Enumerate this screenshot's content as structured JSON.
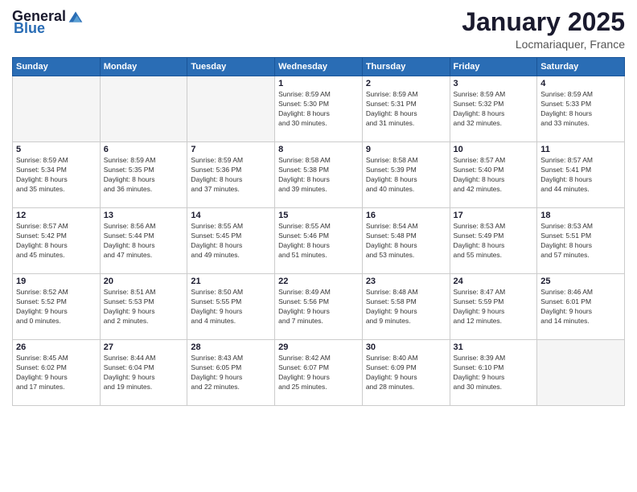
{
  "header": {
    "logo_general": "General",
    "logo_blue": "Blue",
    "month_title": "January 2025",
    "location": "Locmariaquer, France"
  },
  "weekdays": [
    "Sunday",
    "Monday",
    "Tuesday",
    "Wednesday",
    "Thursday",
    "Friday",
    "Saturday"
  ],
  "weeks": [
    [
      {
        "day": "",
        "info": ""
      },
      {
        "day": "",
        "info": ""
      },
      {
        "day": "",
        "info": ""
      },
      {
        "day": "1",
        "info": "Sunrise: 8:59 AM\nSunset: 5:30 PM\nDaylight: 8 hours\nand 30 minutes."
      },
      {
        "day": "2",
        "info": "Sunrise: 8:59 AM\nSunset: 5:31 PM\nDaylight: 8 hours\nand 31 minutes."
      },
      {
        "day": "3",
        "info": "Sunrise: 8:59 AM\nSunset: 5:32 PM\nDaylight: 8 hours\nand 32 minutes."
      },
      {
        "day": "4",
        "info": "Sunrise: 8:59 AM\nSunset: 5:33 PM\nDaylight: 8 hours\nand 33 minutes."
      }
    ],
    [
      {
        "day": "5",
        "info": "Sunrise: 8:59 AM\nSunset: 5:34 PM\nDaylight: 8 hours\nand 35 minutes."
      },
      {
        "day": "6",
        "info": "Sunrise: 8:59 AM\nSunset: 5:35 PM\nDaylight: 8 hours\nand 36 minutes."
      },
      {
        "day": "7",
        "info": "Sunrise: 8:59 AM\nSunset: 5:36 PM\nDaylight: 8 hours\nand 37 minutes."
      },
      {
        "day": "8",
        "info": "Sunrise: 8:58 AM\nSunset: 5:38 PM\nDaylight: 8 hours\nand 39 minutes."
      },
      {
        "day": "9",
        "info": "Sunrise: 8:58 AM\nSunset: 5:39 PM\nDaylight: 8 hours\nand 40 minutes."
      },
      {
        "day": "10",
        "info": "Sunrise: 8:57 AM\nSunset: 5:40 PM\nDaylight: 8 hours\nand 42 minutes."
      },
      {
        "day": "11",
        "info": "Sunrise: 8:57 AM\nSunset: 5:41 PM\nDaylight: 8 hours\nand 44 minutes."
      }
    ],
    [
      {
        "day": "12",
        "info": "Sunrise: 8:57 AM\nSunset: 5:42 PM\nDaylight: 8 hours\nand 45 minutes."
      },
      {
        "day": "13",
        "info": "Sunrise: 8:56 AM\nSunset: 5:44 PM\nDaylight: 8 hours\nand 47 minutes."
      },
      {
        "day": "14",
        "info": "Sunrise: 8:55 AM\nSunset: 5:45 PM\nDaylight: 8 hours\nand 49 minutes."
      },
      {
        "day": "15",
        "info": "Sunrise: 8:55 AM\nSunset: 5:46 PM\nDaylight: 8 hours\nand 51 minutes."
      },
      {
        "day": "16",
        "info": "Sunrise: 8:54 AM\nSunset: 5:48 PM\nDaylight: 8 hours\nand 53 minutes."
      },
      {
        "day": "17",
        "info": "Sunrise: 8:53 AM\nSunset: 5:49 PM\nDaylight: 8 hours\nand 55 minutes."
      },
      {
        "day": "18",
        "info": "Sunrise: 8:53 AM\nSunset: 5:51 PM\nDaylight: 8 hours\nand 57 minutes."
      }
    ],
    [
      {
        "day": "19",
        "info": "Sunrise: 8:52 AM\nSunset: 5:52 PM\nDaylight: 9 hours\nand 0 minutes."
      },
      {
        "day": "20",
        "info": "Sunrise: 8:51 AM\nSunset: 5:53 PM\nDaylight: 9 hours\nand 2 minutes."
      },
      {
        "day": "21",
        "info": "Sunrise: 8:50 AM\nSunset: 5:55 PM\nDaylight: 9 hours\nand 4 minutes."
      },
      {
        "day": "22",
        "info": "Sunrise: 8:49 AM\nSunset: 5:56 PM\nDaylight: 9 hours\nand 7 minutes."
      },
      {
        "day": "23",
        "info": "Sunrise: 8:48 AM\nSunset: 5:58 PM\nDaylight: 9 hours\nand 9 minutes."
      },
      {
        "day": "24",
        "info": "Sunrise: 8:47 AM\nSunset: 5:59 PM\nDaylight: 9 hours\nand 12 minutes."
      },
      {
        "day": "25",
        "info": "Sunrise: 8:46 AM\nSunset: 6:01 PM\nDaylight: 9 hours\nand 14 minutes."
      }
    ],
    [
      {
        "day": "26",
        "info": "Sunrise: 8:45 AM\nSunset: 6:02 PM\nDaylight: 9 hours\nand 17 minutes."
      },
      {
        "day": "27",
        "info": "Sunrise: 8:44 AM\nSunset: 6:04 PM\nDaylight: 9 hours\nand 19 minutes."
      },
      {
        "day": "28",
        "info": "Sunrise: 8:43 AM\nSunset: 6:05 PM\nDaylight: 9 hours\nand 22 minutes."
      },
      {
        "day": "29",
        "info": "Sunrise: 8:42 AM\nSunset: 6:07 PM\nDaylight: 9 hours\nand 25 minutes."
      },
      {
        "day": "30",
        "info": "Sunrise: 8:40 AM\nSunset: 6:09 PM\nDaylight: 9 hours\nand 28 minutes."
      },
      {
        "day": "31",
        "info": "Sunrise: 8:39 AM\nSunset: 6:10 PM\nDaylight: 9 hours\nand 30 minutes."
      },
      {
        "day": "",
        "info": ""
      }
    ]
  ]
}
